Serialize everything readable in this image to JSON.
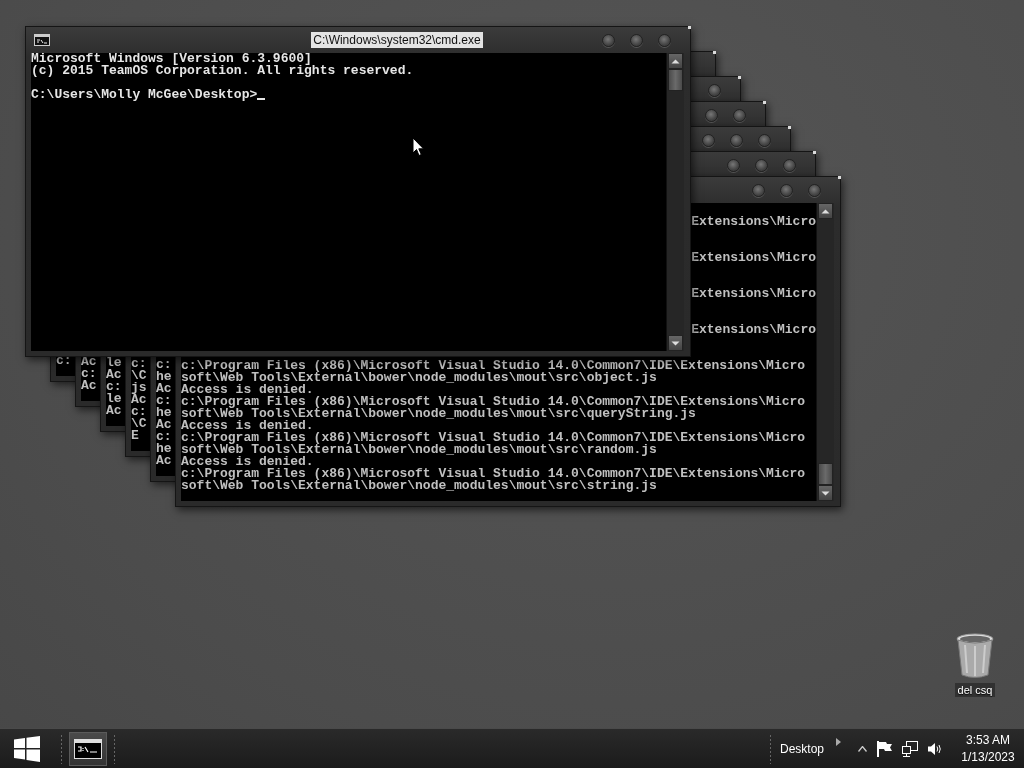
{
  "active_window": {
    "title": "C:\\Windows\\system32\\cmd.exe",
    "buttons": [
      {
        "kind": "minimize"
      },
      {
        "kind": "maximize"
      },
      {
        "kind": "close"
      }
    ],
    "lines": [
      "Microsoft Windows [Version 6.3.9600]",
      "(c) 2015 TeamOS Corporation. All rights reserved."
    ],
    "prompt": "C:\\Users\\Molly McGee\\Desktop>"
  },
  "stacked_windows": [
    {
      "lines": [
        {
          "kind": "text",
          "text": "c:"
        }
      ]
    },
    {
      "buttons": [
        {
          "kind": "close"
        }
      ],
      "lines": [
        {
          "kind": "text",
          "text": "Ac"
        },
        {
          "kind": "text",
          "text": "c:"
        },
        {
          "kind": "text",
          "text": "Ac"
        }
      ]
    },
    {
      "buttons": [
        {
          "kind": "maximize"
        },
        {
          "kind": "close"
        }
      ],
      "lines": [
        {
          "kind": "text",
          "text": "le"
        },
        {
          "kind": "text",
          "text": "Ac"
        },
        {
          "kind": "text",
          "text": "c:"
        },
        {
          "kind": "text",
          "text": "le"
        },
        {
          "kind": "text",
          "text": "Ac"
        }
      ]
    },
    {
      "buttons": [
        {
          "kind": "minimize"
        },
        {
          "kind": "maximize"
        },
        {
          "kind": "close"
        }
      ],
      "lines": [
        {
          "kind": "text",
          "text": "c:"
        },
        {
          "kind": "text",
          "text": "\\C"
        },
        {
          "kind": "text",
          "text": "js"
        },
        {
          "kind": "text",
          "text": "Ac"
        },
        {
          "kind": "text",
          "text": "c:"
        },
        {
          "kind": "text",
          "text": "\\C"
        },
        {
          "kind": "text",
          "text": "E"
        }
      ]
    },
    {
      "buttons": [
        {
          "kind": "minimize"
        },
        {
          "kind": "maximize"
        },
        {
          "kind": "close"
        }
      ],
      "lines": [
        {
          "kind": "text",
          "text": "c:"
        },
        {
          "kind": "text",
          "text": "he"
        },
        {
          "kind": "text",
          "text": "Ac"
        },
        {
          "kind": "text",
          "text": "c:"
        },
        {
          "kind": "text",
          "text": "he"
        },
        {
          "kind": "text",
          "text": "Ac"
        },
        {
          "kind": "text",
          "text": "c:"
        },
        {
          "kind": "text",
          "text": "he"
        },
        {
          "kind": "text",
          "text": "Ac"
        }
      ]
    },
    {
      "buttons": [
        {
          "kind": "minimize"
        },
        {
          "kind": "maximize"
        },
        {
          "kind": "close"
        }
      ],
      "lines": [
        {
          "kind": "tail",
          "text": "Extensions\\Micro"
        },
        {
          "kind": "covered"
        },
        {
          "kind": "covered"
        },
        {
          "kind": "tail",
          "text": "Extensions\\Micro"
        },
        {
          "kind": "covered"
        },
        {
          "kind": "covered"
        },
        {
          "kind": "tail",
          "text": "Extensions\\Micro"
        },
        {
          "kind": "covered"
        },
        {
          "kind": "covered"
        },
        {
          "kind": "tail",
          "text": "Extensions\\Micro"
        },
        {
          "kind": "covered"
        },
        {
          "kind": "covered"
        },
        {
          "kind": "text",
          "text": "c:\\Program Files (x86)\\Microsoft Visual Studio 14.0\\Common7\\IDE\\Extensions\\Micro"
        },
        {
          "kind": "text",
          "text": "soft\\Web Tools\\External\\bower\\node_modules\\mout\\src\\object.js"
        },
        {
          "kind": "text",
          "text": "Access is denied."
        },
        {
          "kind": "text",
          "text": "c:\\Program Files (x86)\\Microsoft Visual Studio 14.0\\Common7\\IDE\\Extensions\\Micro"
        },
        {
          "kind": "text",
          "text": "soft\\Web Tools\\External\\bower\\node_modules\\mout\\src\\queryString.js"
        },
        {
          "kind": "text",
          "text": "Access is denied."
        },
        {
          "kind": "text",
          "text": "c:\\Program Files (x86)\\Microsoft Visual Studio 14.0\\Common7\\IDE\\Extensions\\Micro"
        },
        {
          "kind": "text",
          "text": "soft\\Web Tools\\External\\bower\\node_modules\\mout\\src\\random.js"
        },
        {
          "kind": "text",
          "text": "Access is denied."
        },
        {
          "kind": "text",
          "text": "c:\\Program Files (x86)\\Microsoft Visual Studio 14.0\\Common7\\IDE\\Extensions\\Micro"
        },
        {
          "kind": "text",
          "text": "soft\\Web Tools\\External\\bower\\node_modules\\mout\\src\\string.js"
        }
      ]
    }
  ],
  "desktop_icons": [
    {
      "kind": "recycle-bin",
      "label": "del csq"
    }
  ],
  "taskbar": {
    "apps": [
      {
        "kind": "console",
        "selected": true
      }
    ],
    "toolbar_label": "Desktop",
    "time": "3:53 AM",
    "date": "1/13/2023"
  }
}
